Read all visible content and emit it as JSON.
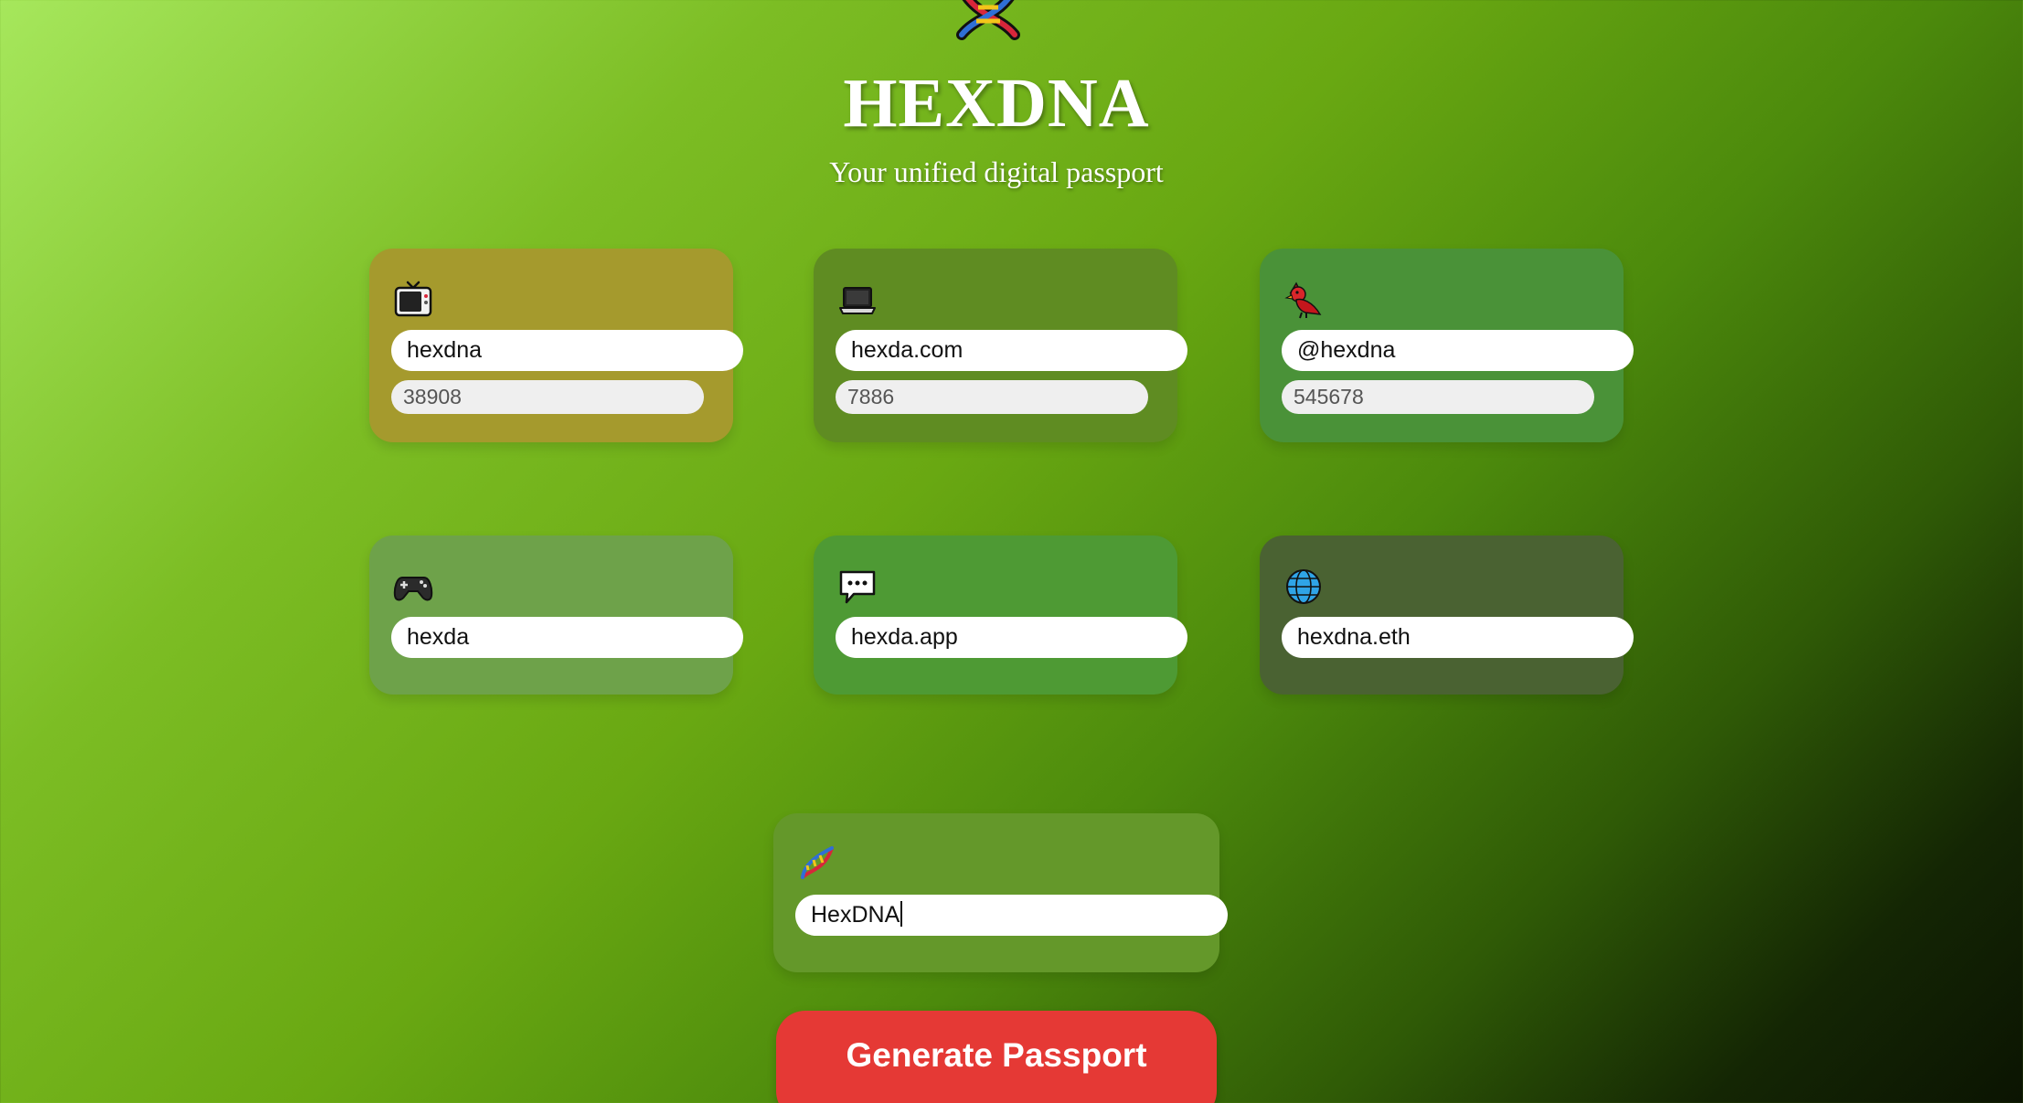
{
  "header": {
    "title": "HEXDNA",
    "subtitle": "Your unified digital passport"
  },
  "cards": [
    {
      "icon": "tv-icon",
      "value": "hexdna",
      "count": "38908",
      "color": "#a59a2d"
    },
    {
      "icon": "laptop-icon",
      "value": "hexda.com",
      "count": "7886",
      "color": "#5f8c22"
    },
    {
      "icon": "cardinal-bird-icon",
      "value": "@hexdna",
      "count": "545678",
      "color": "#4a9238"
    },
    {
      "icon": "game-controller-icon",
      "value": "hexda",
      "color": "#6ea24a"
    },
    {
      "icon": "speech-bubble-icon",
      "value": "hexda.app",
      "color": "#4e9a34"
    },
    {
      "icon": "globe-icon",
      "value": "hexdna.eth",
      "color": "#4a6232"
    }
  ],
  "passport_card": {
    "icon": "dna-icon",
    "value": "HexDNA",
    "color": "#64982a"
  },
  "generate_button": {
    "label": "Generate Passport",
    "color": "#e53935"
  }
}
